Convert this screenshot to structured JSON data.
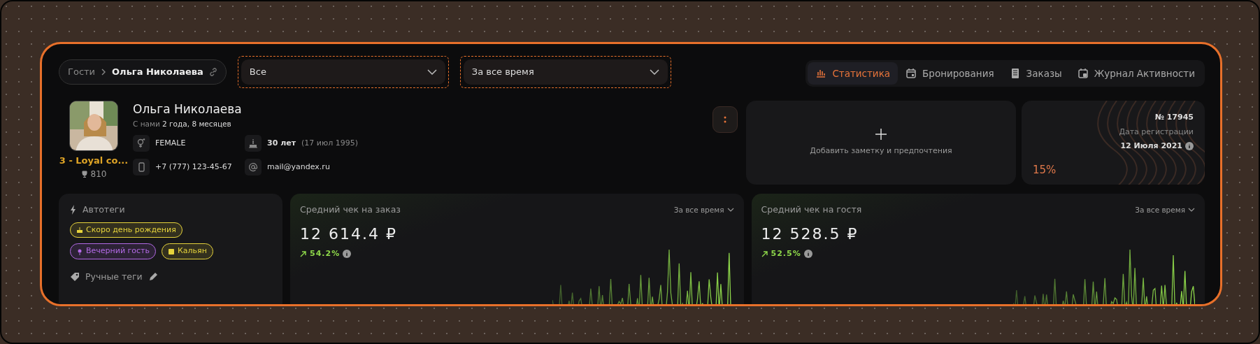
{
  "breadcrumb": {
    "parent": "Гости",
    "current": "Ольга Николаева"
  },
  "filters": [
    {
      "value": "Все"
    },
    {
      "value": "За все время"
    }
  ],
  "tabs": [
    {
      "label": "Статистика",
      "kind": "stats",
      "selected": true
    },
    {
      "label": "Бронирования",
      "kind": "calendar",
      "selected": false
    },
    {
      "label": "Заказы",
      "kind": "receipt",
      "selected": false
    },
    {
      "label": "Журнал Активности",
      "kind": "log",
      "selected": false
    }
  ],
  "profile": {
    "name": "Ольга Николаева",
    "tenure": "С нами **2 года, 8 месяцев**",
    "loyalty": "3 - Loyal co...",
    "points": "810",
    "gender": "FEMALE",
    "age": "30 лет",
    "birthdate": "(17 июл 1995)",
    "phone": "+7 (777) 123-45-67",
    "email": "mail@yandex.ru"
  },
  "note": {
    "label": "Добавить заметку и предпочтения"
  },
  "registration": {
    "number": "№ 17945",
    "label": "Дата регистрации",
    "date": "12 Июля 2021",
    "percent": "15%"
  },
  "autotags": {
    "title": "Автотеги",
    "tags": [
      {
        "label": "Скоро день рождения",
        "kind": "birthday",
        "color": "#e6d33c"
      },
      {
        "label": "Вечерний гость",
        "kind": "evening",
        "color": "#b36ae6"
      },
      {
        "label": "Кальян",
        "kind": "hookah",
        "color": "#e6d33c"
      }
    ],
    "manual_title": "Ручные теги"
  },
  "metrics": [
    {
      "title": "Средний чек на заказ",
      "period": "За все время",
      "value": "12 614.4 ₽",
      "change": "54.2%"
    },
    {
      "title": "Средний чек на гостя",
      "period": "За все время",
      "value": "12 528.5 ₽",
      "change": "52.5%"
    }
  ]
}
